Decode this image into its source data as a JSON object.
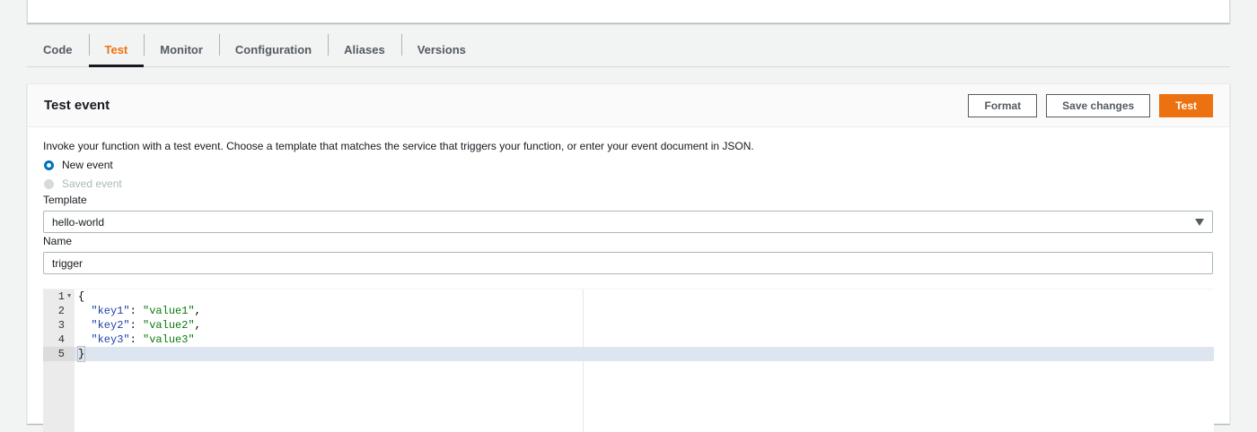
{
  "tabs": [
    {
      "label": "Code",
      "active": false
    },
    {
      "label": "Test",
      "active": true
    },
    {
      "label": "Monitor",
      "active": false
    },
    {
      "label": "Configuration",
      "active": false
    },
    {
      "label": "Aliases",
      "active": false
    },
    {
      "label": "Versions",
      "active": false
    }
  ],
  "test_event": {
    "title": "Test event",
    "buttons": {
      "format": "Format",
      "save": "Save changes",
      "test": "Test"
    },
    "description": "Invoke your function with a test event. Choose a template that matches the service that triggers your function, or enter your event document in JSON.",
    "radio_new": "New event",
    "radio_saved": "Saved event",
    "template_label": "Template",
    "template_value": "hello-world",
    "name_label": "Name",
    "name_value": "trigger"
  },
  "editor": {
    "lines": [
      {
        "num": "1",
        "text": "{"
      },
      {
        "num": "2",
        "key": "\"key1\"",
        "value": "\"value1\"",
        "trail": ","
      },
      {
        "num": "3",
        "key": "\"key2\"",
        "value": "\"value2\"",
        "trail": ","
      },
      {
        "num": "4",
        "key": "\"key3\"",
        "value": "\"value3\"",
        "trail": ""
      },
      {
        "num": "5",
        "text": "}"
      }
    ]
  },
  "colors": {
    "accent": "#ec7211",
    "radio": "#0073bb",
    "json_key": "#1f3fa8",
    "json_string": "#0b7a0b"
  }
}
